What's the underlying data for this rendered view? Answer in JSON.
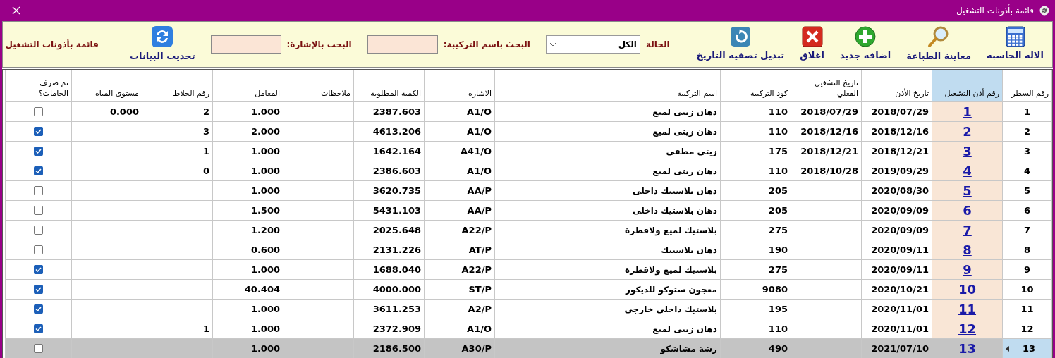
{
  "window": {
    "title": "قائمة بأذونات التشغيل"
  },
  "toolbar": {
    "buttons": [
      {
        "kind": "calculator",
        "label": "الالة الحاسبة"
      },
      {
        "kind": "preview",
        "label": "معاينة الطباعة"
      },
      {
        "kind": "add",
        "label": "اضافة جديد"
      },
      {
        "kind": "close",
        "label": "اغلاق"
      },
      {
        "kind": "date_filter",
        "label": "تبديل تصفية التاريخ"
      }
    ],
    "status_filter": {
      "label": "الحالة",
      "value": "الكل"
    },
    "search_name": {
      "label": "البحث باسم التركيبة:"
    },
    "search_sign": {
      "label": "البحث بالإشارة:"
    },
    "refresh_button": {
      "label": "تحديث البيانات"
    },
    "form_label": "قائمة بأذونات التشغيل"
  },
  "table": {
    "columns": [
      {
        "label": "رقم السطر",
        "selected": false
      },
      {
        "label": "رقم أذن التشغيل",
        "selected": true
      },
      {
        "label": "تاريخ الأذن",
        "selected": false
      },
      {
        "label": "تاريخ التشغيل الفعلي",
        "selected": false
      },
      {
        "label": "كود التركيبة",
        "selected": false
      },
      {
        "label": "اسم التركيبة",
        "selected": false
      },
      {
        "label": "الاشارة",
        "selected": false
      },
      {
        "label": "الكمية المطلوبة",
        "selected": false
      },
      {
        "label": "ملاحظات",
        "selected": false
      },
      {
        "label": "المعامل",
        "selected": false
      },
      {
        "label": "رقم الخلاط",
        "selected": false
      },
      {
        "label": "مستوى المياه",
        "selected": false
      },
      {
        "label": "تم صرف الخامات؟",
        "selected": false
      }
    ],
    "rows": [
      {
        "cells": [
          "1",
          "1",
          "2018/07/29",
          "2018/07/29",
          "110",
          "دهان زيتى لميع",
          "A1/O",
          "2387.603",
          "",
          "1.000",
          "2",
          "0.000"
        ],
        "materials_issued": false,
        "selected": false
      },
      {
        "cells": [
          "2",
          "2",
          "2018/12/16",
          "2018/12/16",
          "110",
          "دهان زيتى لميع",
          "A1/O",
          "4613.206",
          "",
          "2.000",
          "3",
          ""
        ],
        "materials_issued": true,
        "selected": false
      },
      {
        "cells": [
          "3",
          "3",
          "2018/12/21",
          "2018/12/21",
          "175",
          "زيتى مطفى",
          "A41/O",
          "1642.164",
          "",
          "1.000",
          "1",
          ""
        ],
        "materials_issued": true,
        "selected": false
      },
      {
        "cells": [
          "4",
          "4",
          "2019/09/29",
          "2018/10/28",
          "110",
          "دهان زيتى لميع",
          "A1/O",
          "2386.603",
          "",
          "1.000",
          "0",
          ""
        ],
        "materials_issued": true,
        "selected": false
      },
      {
        "cells": [
          "5",
          "5",
          "2020/08/30",
          "",
          "205",
          "دهان بلاستيك داخلى",
          "AA/P",
          "3620.735",
          "",
          "1.000",
          "",
          ""
        ],
        "materials_issued": false,
        "selected": false
      },
      {
        "cells": [
          "6",
          "6",
          "2020/09/09",
          "",
          "205",
          "دهان بلاستيك داخلى",
          "AA/P",
          "5431.103",
          "",
          "1.500",
          "",
          ""
        ],
        "materials_issued": false,
        "selected": false
      },
      {
        "cells": [
          "7",
          "7",
          "2020/09/09",
          "",
          "275",
          "بلاستيك لميع ولاقطرة",
          "A22/P",
          "2025.648",
          "",
          "1.200",
          "",
          ""
        ],
        "materials_issued": false,
        "selected": false
      },
      {
        "cells": [
          "8",
          "8",
          "2020/09/11",
          "",
          "190",
          "دهان بلاستيك",
          "AT/P",
          "2131.226",
          "",
          "0.600",
          "",
          ""
        ],
        "materials_issued": false,
        "selected": false
      },
      {
        "cells": [
          "9",
          "9",
          "2020/09/11",
          "",
          "275",
          "بلاستيك لميع ولاقطرة",
          "A22/P",
          "1688.040",
          "",
          "1.000",
          "",
          ""
        ],
        "materials_issued": true,
        "selected": false
      },
      {
        "cells": [
          "10",
          "10",
          "2020/10/21",
          "",
          "9080",
          "معجون ستوكو للديكور",
          "ST/P",
          "4000.000",
          "",
          "40.404",
          "",
          ""
        ],
        "materials_issued": true,
        "selected": false
      },
      {
        "cells": [
          "11",
          "11",
          "2020/11/01",
          "",
          "195",
          "بلاستيك داخلى خارجى",
          "A2/P",
          "3611.253",
          "",
          "1.000",
          "",
          ""
        ],
        "materials_issued": true,
        "selected": false
      },
      {
        "cells": [
          "12",
          "12",
          "2020/11/01",
          "",
          "110",
          "دهان زيتى لميع",
          "A1/O",
          "2372.909",
          "",
          "1.000",
          "1",
          ""
        ],
        "materials_issued": true,
        "selected": false
      },
      {
        "cells": [
          "13",
          "13",
          "2021/07/10",
          "",
          "490",
          "رشة مشاشكو",
          "A30/P",
          "2186.500",
          "",
          "1.000",
          "",
          ""
        ],
        "materials_issued": false,
        "selected": true
      }
    ]
  }
}
